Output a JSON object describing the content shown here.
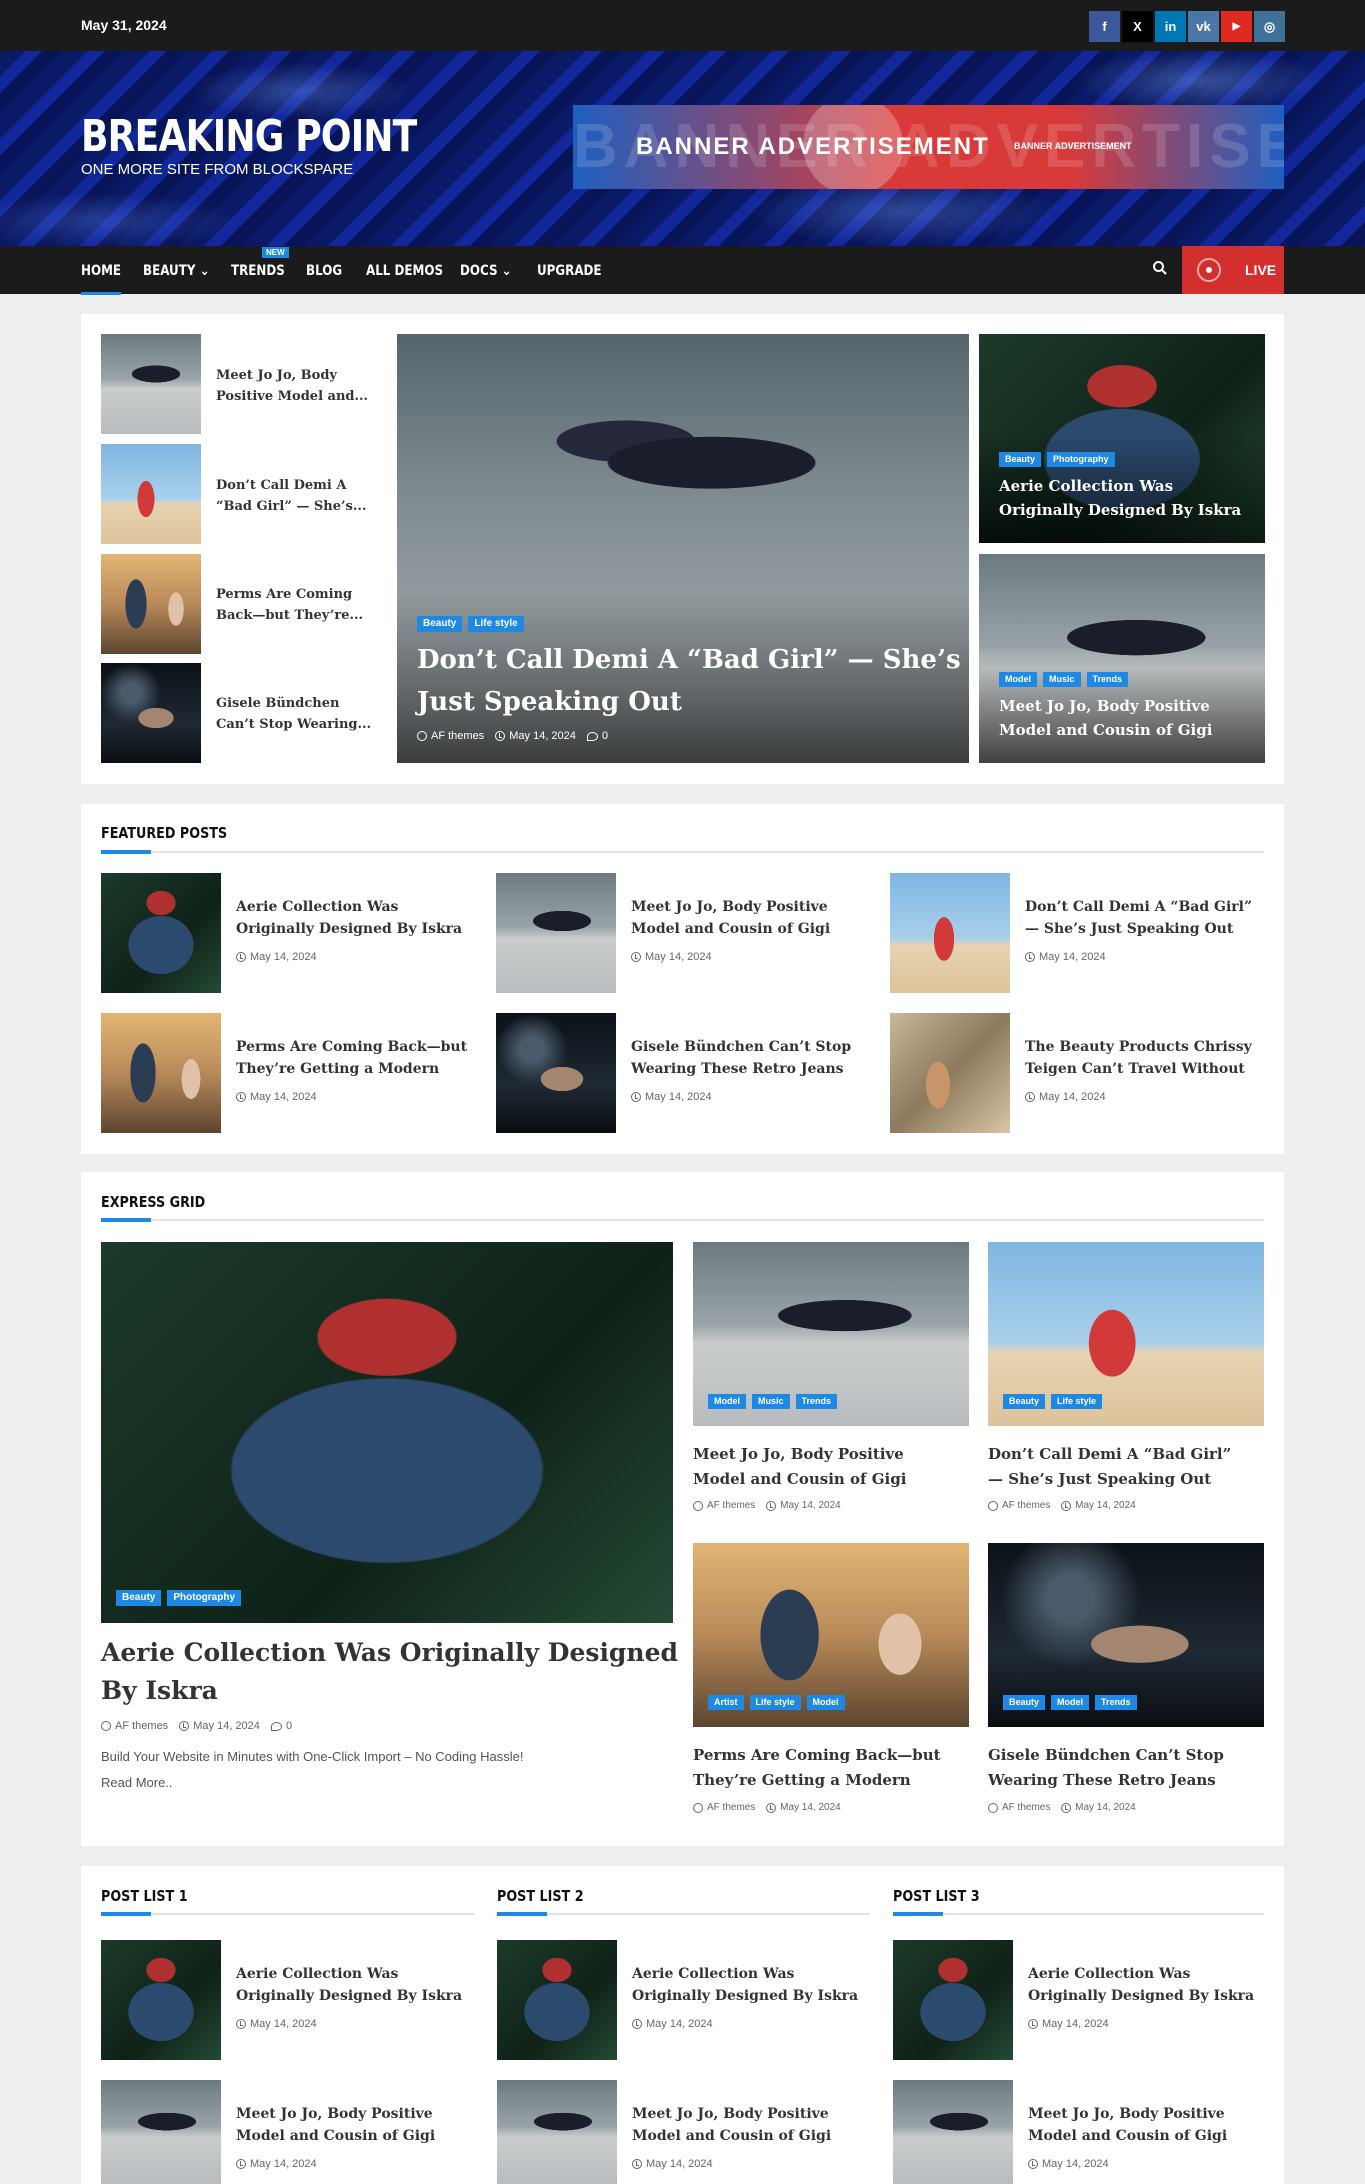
{
  "topbar": {
    "date": "May 31, 2024",
    "socials": [
      {
        "name": "facebook",
        "glyph": "f",
        "color": "#3b5998"
      },
      {
        "name": "x",
        "glyph": "X",
        "color": "#000000"
      },
      {
        "name": "linkedin",
        "glyph": "in",
        "color": "#0077b5"
      },
      {
        "name": "vk",
        "glyph": "vk",
        "color": "#4a76a8"
      },
      {
        "name": "youtube",
        "glyph": "▶",
        "color": "#e02a20"
      },
      {
        "name": "instagram",
        "glyph": "◎",
        "color": "#3f729b"
      }
    ]
  },
  "header": {
    "title": "BREAKING POINT",
    "tagline": "ONE MORE SITE FROM BLOCKSPARE",
    "banner": {
      "text": "BANNER ADVERTISEMENT",
      "small": "BANNER ADVERTISEMENT"
    }
  },
  "nav": {
    "items": [
      "HOME",
      "BEAUTY",
      "TRENDS",
      "BLOG",
      "ALL DEMOS",
      "DOCS",
      "UPGRADE"
    ],
    "new_badge": "NEW",
    "live": "LIVE"
  },
  "colors": {
    "accent": "#1e88e5",
    "live": "#d32f2f",
    "topbar": "#1b1b1b"
  },
  "hero": {
    "left_list": [
      {
        "title_l1": "Meet Jo Jo, Body",
        "title_l2": "Positive Model and..."
      },
      {
        "title_l1": "Don’t Call Demi A",
        "title_l2": "“Bad Girl” — She’s..."
      },
      {
        "title_l1": "Perms Are Coming",
        "title_l2": "Back—but They’re..."
      },
      {
        "title_l1": "Gisele Bündchen",
        "title_l2": "Can’t Stop Wearing..."
      }
    ],
    "main": {
      "tags": [
        "Beauty",
        "Life style"
      ],
      "title_l1": "Don’t Call Demi A “Bad Girl” — She’s",
      "title_l2": "Just Speaking Out",
      "author": "AF themes",
      "date": "May 14, 2024",
      "comments": "0"
    },
    "right_top": {
      "tags": [
        "Beauty",
        "Photography"
      ],
      "title_l1": "Aerie Collection Was",
      "title_l2": "Originally Designed By Iskra"
    },
    "right_bottom": {
      "tags": [
        "Model",
        "Music",
        "Trends"
      ],
      "title_l1": "Meet Jo Jo, Body Positive",
      "title_l2": "Model and Cousin of Gigi"
    }
  },
  "featured": {
    "heading": "FEATURED POSTS",
    "posts": [
      {
        "l1": "Aerie Collection Was",
        "l2": "Originally Designed By Iskra",
        "date": "May 14, 2024"
      },
      {
        "l1": "Meet Jo Jo, Body Positive",
        "l2": "Model and Cousin of Gigi",
        "date": "May 14, 2024"
      },
      {
        "l1": "Don’t Call Demi A “Bad Girl”",
        "l2": "— She’s Just Speaking Out",
        "date": "May 14, 2024"
      },
      {
        "l1": "Perms Are Coming Back—but",
        "l2": "They’re Getting a Modern",
        "date": "May 14, 2024"
      },
      {
        "l1": "Gisele Bündchen Can’t Stop",
        "l2": "Wearing These Retro Jeans",
        "date": "May 14, 2024"
      },
      {
        "l1": "The Beauty Products Chrissy",
        "l2": "Teigen Can’t Travel Without",
        "date": "May 14, 2024"
      }
    ]
  },
  "express": {
    "heading": "EXPRESS GRID",
    "big": {
      "tags": [
        "Beauty",
        "Photography"
      ],
      "l1": "Aerie Collection Was Originally Designed",
      "l2": "By Iskra",
      "author": "AF themes",
      "date": "May 14, 2024",
      "comments": "0",
      "excerpt": "Build Your Website in Minutes with One-Click Import – No Coding Hassle!",
      "read_more": "Read More.."
    },
    "cards": [
      {
        "tags": [
          "Model",
          "Music",
          "Trends"
        ],
        "l1": "Meet Jo Jo, Body Positive",
        "l2": "Model and Cousin of Gigi",
        "author": "AF themes",
        "date": "May 14, 2024"
      },
      {
        "tags": [
          "Beauty",
          "Life style"
        ],
        "l1": "Don’t Call Demi A “Bad Girl”",
        "l2": "— She’s Just Speaking Out",
        "author": "AF themes",
        "date": "May 14, 2024"
      },
      {
        "tags": [
          "Artist",
          "Life style",
          "Model"
        ],
        "l1": "Perms Are Coming Back—but",
        "l2": "They’re Getting a Modern",
        "author": "AF themes",
        "date": "May 14, 2024"
      },
      {
        "tags": [
          "Beauty",
          "Model",
          "Trends"
        ],
        "l1": "Gisele Bündchen Can’t Stop",
        "l2": "Wearing These Retro Jeans",
        "author": "AF themes",
        "date": "May 14, 2024"
      }
    ]
  },
  "postlists": [
    {
      "heading": "POST LIST 1",
      "posts": [
        {
          "l1": "Aerie Collection Was",
          "l2": "Originally Designed By Iskra",
          "date": "May 14, 2024"
        },
        {
          "l1": "Meet Jo Jo, Body Positive",
          "l2": "Model and Cousin of Gigi",
          "date": "May 14, 2024"
        }
      ]
    },
    {
      "heading": "POST LIST 2",
      "posts": [
        {
          "l1": "Aerie Collection Was",
          "l2": "Originally Designed By Iskra",
          "date": "May 14, 2024"
        },
        {
          "l1": "Meet Jo Jo, Body Positive",
          "l2": "Model and Cousin of Gigi",
          "date": "May 14, 2024"
        }
      ]
    },
    {
      "heading": "POST LIST 3",
      "posts": [
        {
          "l1": "Aerie Collection Was",
          "l2": "Originally Designed By Iskra",
          "date": "May 14, 2024"
        },
        {
          "l1": "Meet Jo Jo, Body Positive",
          "l2": "Model and Cousin of Gigi",
          "date": "May 14, 2024"
        }
      ]
    }
  ]
}
